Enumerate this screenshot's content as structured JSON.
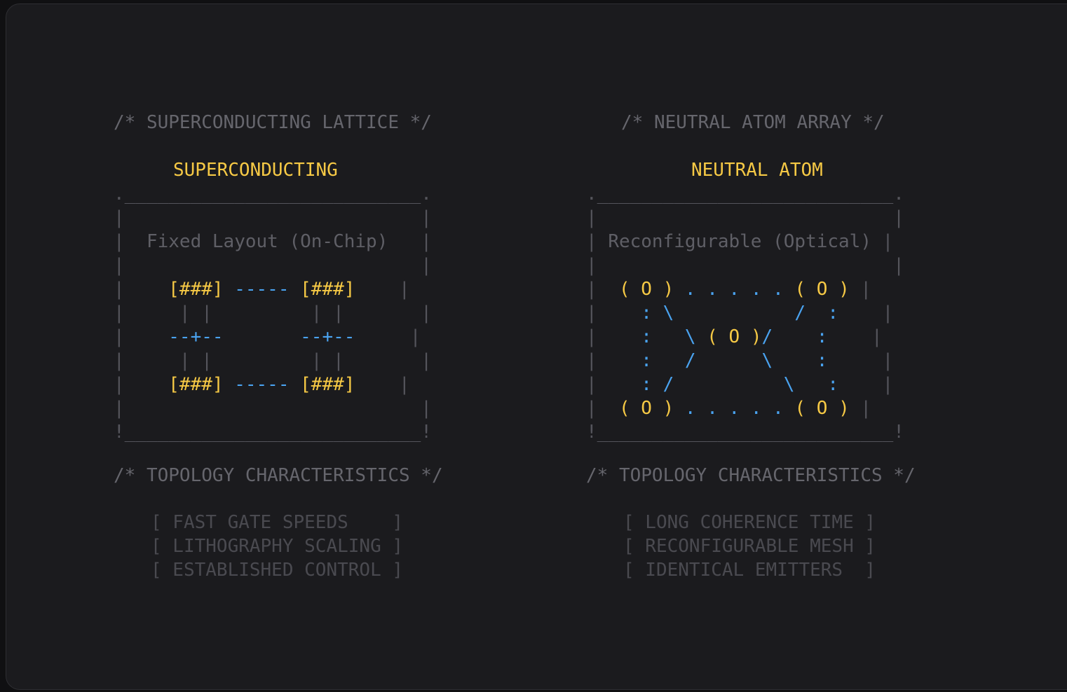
{
  "left": {
    "comment": "/* SUPERCONDUCTING LATTICE */",
    "title": "SUPERCONDUCTING",
    "box_label": "Fixed Layout (On-Chip)",
    "topology_comment": "/* TOPOLOGY CHARACTERISTICS */",
    "characteristics": [
      "[ FAST GATE SPEEDS    ]",
      "[ LITHOGRAPHY SCALING ]",
      "[ ESTABLISHED CONTROL ]"
    ]
  },
  "right": {
    "comment": "/* NEUTRAL ATOM ARRAY */",
    "title": "NEUTRAL ATOM",
    "box_label": "Reconfigurable (Optical)",
    "topology_comment": "/* TOPOLOGY CHARACTERISTICS */",
    "characteristics": [
      "[ LONG COHERENCE TIME ]",
      "[ RECONFIGURABLE MESH ]",
      "[ IDENTICAL EMITTERS  ]"
    ]
  },
  "colors": {
    "background": "#1b1b1e",
    "accent_yellow": "#f6c945",
    "accent_blue": "#4aa3f0",
    "comment_gray": "#66666d",
    "frame_gray": "#55555c"
  }
}
